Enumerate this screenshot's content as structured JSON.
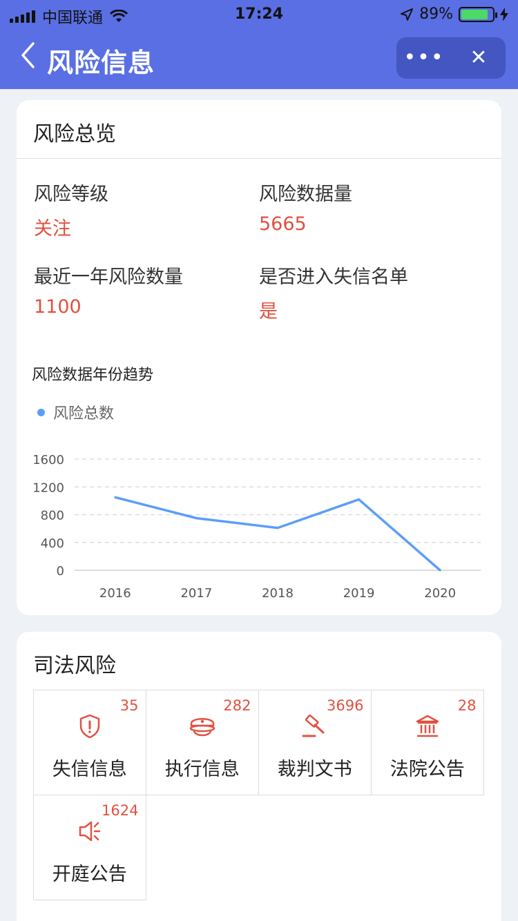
{
  "status_bar": {
    "carrier": "中国联通",
    "time": "17:24",
    "battery_pct": "89%"
  },
  "nav": {
    "back_icon": "chevron-left-icon",
    "title": "风险信息",
    "more_label": "•••",
    "close_label": "✕"
  },
  "overview": {
    "title": "风险总览",
    "level_label": "风险等级",
    "level_value": "关注",
    "data_count_label": "风险数据量",
    "data_count_value": "5665",
    "recent_label": "最近一年风险数量",
    "recent_value": "1100",
    "blacklist_label": "是否进入失信名单",
    "blacklist_value": "是"
  },
  "chart": {
    "title": "风险数据年份趋势",
    "legend_label": "风险总数"
  },
  "chart_data": {
    "type": "line",
    "title": "风险数据年份趋势",
    "x": [
      "2016",
      "2017",
      "2018",
      "2019",
      "2020"
    ],
    "series": [
      {
        "name": "风险总数",
        "values": [
          1050,
          750,
          610,
          1020,
          0
        ],
        "color": "#5b9ef7"
      }
    ],
    "y_ticks": [
      0,
      400,
      800,
      1200,
      1600
    ],
    "ylim": [
      0,
      1600
    ],
    "grid": true,
    "legend_position": "top-left"
  },
  "judicial": {
    "title": "司法风险",
    "items": [
      {
        "label": "失信信息",
        "count": "35",
        "icon": "shield-alert-icon"
      },
      {
        "label": "执行信息",
        "count": "282",
        "icon": "police-cap-icon"
      },
      {
        "label": "裁判文书",
        "count": "3696",
        "icon": "gavel-icon"
      },
      {
        "label": "法院公告",
        "count": "28",
        "icon": "courthouse-icon"
      },
      {
        "label": "开庭公告",
        "count": "1624",
        "icon": "megaphone-icon"
      }
    ]
  },
  "colors": {
    "nav_bg": "#5a6fe3",
    "accent_red": "#e25040",
    "series_blue": "#5b9ef7"
  }
}
